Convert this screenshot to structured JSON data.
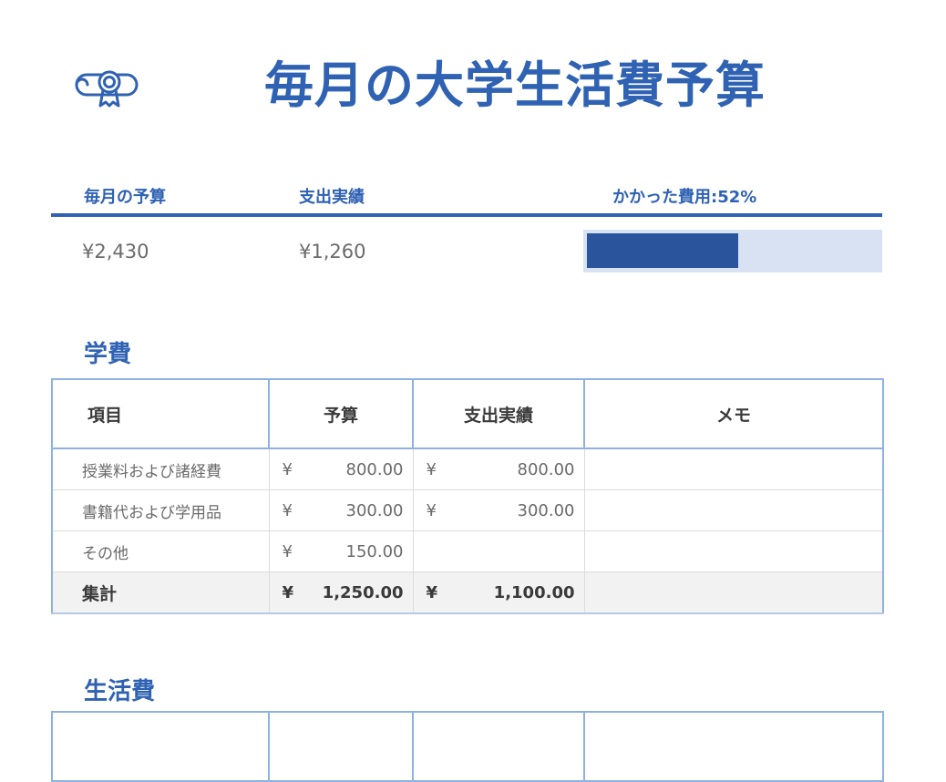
{
  "page": {
    "title": "毎月の大学生活費予算",
    "logo_icon": "diploma-icon",
    "accent_color": "#2f62b3"
  },
  "summary": {
    "monthly_budget_label": "毎月の予算",
    "actual_label": "支出実績",
    "spent_label": "かかった費用:52%",
    "monthly_budget_value": "¥2,430",
    "actual_value": "¥1,260",
    "spent_fraction": 0.52
  },
  "tuition": {
    "title": "学費",
    "headers": [
      "項目",
      "予算",
      "支出実績",
      "メモ"
    ],
    "rows": [
      {
        "item": "授業料および諸経費",
        "budget_cur": "¥",
        "budget": "800.00",
        "actual_cur": "¥",
        "actual": "800.00",
        "memo": ""
      },
      {
        "item": "書籍代および学用品",
        "budget_cur": "¥",
        "budget": "300.00",
        "actual_cur": "¥",
        "actual": "300.00",
        "memo": ""
      },
      {
        "item": "その他",
        "budget_cur": "¥",
        "budget": "150.00",
        "actual_cur": "",
        "actual": "",
        "memo": ""
      }
    ],
    "total": {
      "item": "集計",
      "budget_cur": "¥",
      "budget": "1,250.00",
      "actual_cur": "¥",
      "actual": "1,100.00",
      "memo": ""
    }
  },
  "living": {
    "title": "生活費"
  }
}
